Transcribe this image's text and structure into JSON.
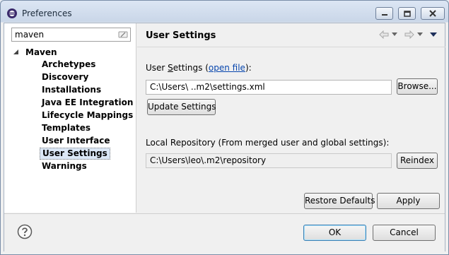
{
  "window": {
    "title": "Preferences",
    "icon": "eclipse-icon"
  },
  "sidebar": {
    "filter": {
      "value": "maven",
      "placeholder": "type filter text"
    },
    "root": {
      "label": "Maven",
      "expanded": true
    },
    "items": [
      {
        "label": "Archetypes",
        "selected": false
      },
      {
        "label": "Discovery",
        "selected": false
      },
      {
        "label": "Installations",
        "selected": false
      },
      {
        "label": "Java EE Integration",
        "selected": false
      },
      {
        "label": "Lifecycle Mappings",
        "selected": false
      },
      {
        "label": "Templates",
        "selected": false
      },
      {
        "label": "User Interface",
        "selected": false
      },
      {
        "label": "User Settings",
        "selected": true
      },
      {
        "label": "Warnings",
        "selected": false
      }
    ]
  },
  "page": {
    "title": "User Settings",
    "user_settings_label_pre": "User ",
    "user_settings_label_mnemonic": "S",
    "user_settings_label_post": "ettings (",
    "open_file_link": "open file",
    "user_settings_label_close": "):",
    "user_settings_path": "C:\\Users\\        ..m2\\settings.xml",
    "browse_button": "Browse...",
    "update_settings_button": "Update Settings",
    "local_repo_label": "Local Repository (From merged user and global settings):",
    "local_repo_path": "C:\\Users\\leo\\.m2\\repository",
    "reindex_button": "Reindex",
    "restore_defaults_button": "Restore Defaults",
    "apply_button": "Apply"
  },
  "footer": {
    "ok_button": "OK",
    "cancel_button": "Cancel"
  },
  "colors": {
    "link": "#0645ad",
    "selection": "#dbe7f6",
    "default_button_border": "#3c7fb1"
  }
}
